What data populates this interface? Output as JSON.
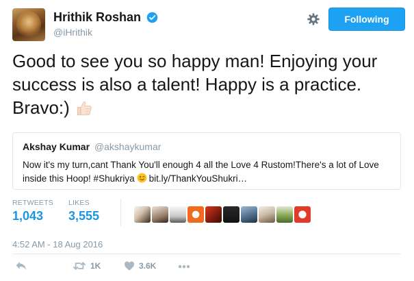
{
  "tweet": {
    "author": {
      "name": "Hrithik Roshan",
      "handle": "@iHrithik",
      "verified": true
    },
    "follow_button": "Following",
    "text": "Good to see you so happy man! Enjoying your success is also a talent! Happy is a practice. Bravo:)",
    "text_emoji": "thumbs-up-light-skin-icon",
    "quoted": {
      "name": "Akshay Kumar",
      "handle": "@akshaykumar",
      "text_before_emoji": "Now it's my turn,cant Thank You'll enough 4 all the Love 4 Rustom!There's a lot of Love inside this Hoop! #Shukriya",
      "emoji": "winking-face-tongue-icon",
      "link": "bit.ly/ThankYouShukri…"
    },
    "stats": {
      "retweets_label": "RETWEETS",
      "retweets": "1,043",
      "likes_label": "LIKES",
      "likes": "3,555"
    },
    "likers_count": 10,
    "timestamp": "4:52 AM - 18 Aug 2016",
    "actions": {
      "reply_icon": "reply-icon",
      "retweet_icon": "retweet-icon",
      "retweet_count": "1K",
      "like_icon": "heart-icon",
      "like_count": "3.6K",
      "more_icon": "more-dots-icon"
    }
  },
  "colors": {
    "accent": "#1da1f2",
    "link": "#1b95e0",
    "muted": "#8899a6",
    "border": "#e1e8ed",
    "text": "#14171a"
  }
}
